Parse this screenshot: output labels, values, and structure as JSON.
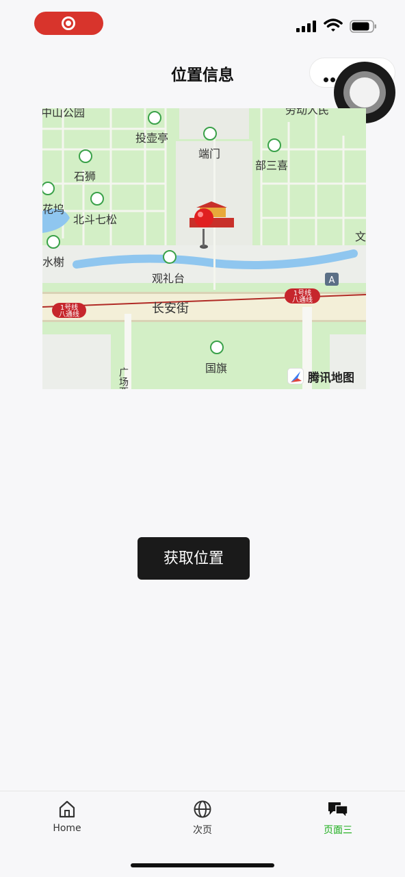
{
  "nav": {
    "title": "位置信息"
  },
  "map": {
    "labels": {
      "zhongshan": "中山公园",
      "touhu": "投壶亭",
      "laodong": "劳动人民",
      "duanmen": "端门",
      "sanxi": "部三喜",
      "shishi": "石狮",
      "huawu": "花坞",
      "beidou": "北斗七松",
      "shuixie": "水榭",
      "guanli": "观礼台",
      "wen": "文",
      "changan": "长安街",
      "guoqi": "国旗",
      "guangchang": "广场西",
      "metro_left_1": "1号线",
      "metro_left_2": "八通线",
      "metro_right_1": "1号线",
      "metro_right_2": "八通线",
      "exit_a": "A"
    },
    "brand": "腾讯地图"
  },
  "actions": {
    "get_location": "获取位置"
  },
  "tabbar": {
    "home": "Home",
    "second": "次页",
    "third": "页面三",
    "active_color": "#1aad19"
  }
}
